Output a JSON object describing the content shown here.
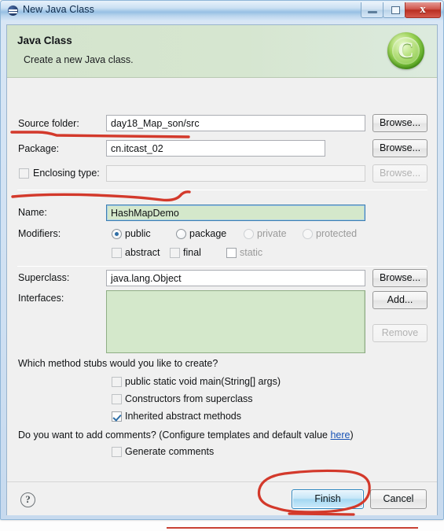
{
  "window": {
    "title": "New Java Class",
    "icon": "eclipse-icon",
    "controls": {
      "minimize": "minimize-icon",
      "maximize": "maximize-icon",
      "close": "x"
    }
  },
  "header": {
    "title": "Java Class",
    "subtitle": "Create a new Java class.",
    "icon": "java-class-wizard-icon",
    "icon_letter": "C",
    "background_color": "#d6e6d0"
  },
  "form": {
    "source_folder": {
      "label": "Source folder:",
      "value": "day18_Map_son/src",
      "button": "Browse..."
    },
    "package": {
      "label": "Package:",
      "value": "cn.itcast_02",
      "button": "Browse..."
    },
    "enclosing_type": {
      "label": "Enclosing type:",
      "value": "",
      "checked": false,
      "button": "Browse...",
      "enabled": false
    },
    "name": {
      "label": "Name:",
      "value": "HashMapDemo",
      "focused": true
    },
    "modifiers": {
      "label": "Modifiers:",
      "radios": [
        {
          "label": "public",
          "selected": true,
          "enabled": true
        },
        {
          "label": "package",
          "selected": false,
          "enabled": true
        },
        {
          "label": "private",
          "selected": false,
          "enabled": false
        },
        {
          "label": "protected",
          "selected": false,
          "enabled": false
        }
      ],
      "checkboxes": [
        {
          "label": "abstract",
          "checked": false,
          "enabled": true
        },
        {
          "label": "final",
          "checked": false,
          "enabled": true
        },
        {
          "label": "static",
          "checked": false,
          "enabled": false
        }
      ]
    },
    "superclass": {
      "label": "Superclass:",
      "value": "java.lang.Object",
      "button": "Browse..."
    },
    "interfaces": {
      "label": "Interfaces:",
      "value": "",
      "add_button": "Add...",
      "remove_button": "Remove",
      "remove_enabled": false
    },
    "method_stubs": {
      "question": "Which method stubs would you like to create?",
      "options": [
        {
          "label": "public static void main(String[] args)",
          "checked": false
        },
        {
          "label": "Constructors from superclass",
          "checked": false
        },
        {
          "label": "Inherited abstract methods",
          "checked": true
        }
      ]
    },
    "comments": {
      "question_prefix": "Do you want to add comments? (Configure templates and default value ",
      "link": "here",
      "question_suffix": ")",
      "option": {
        "label": "Generate comments",
        "checked": false
      }
    }
  },
  "footer": {
    "help": "?",
    "finish": "Finish",
    "cancel": "Cancel"
  },
  "annotations": {
    "color": "#d3392b",
    "marks": [
      "underline-package-label",
      "underline-name-label",
      "ellipse-around-finish-button",
      "underline-below-finish-button",
      "line-at-bottom-taskbar"
    ]
  }
}
